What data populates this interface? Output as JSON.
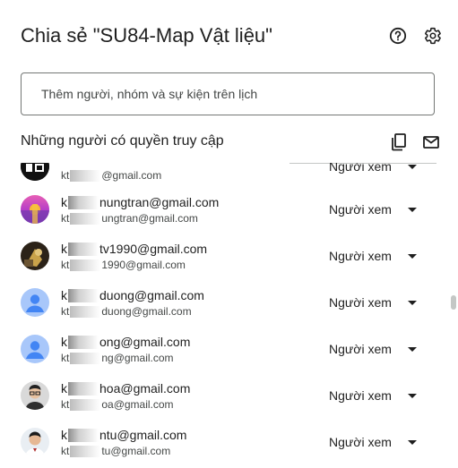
{
  "dialog": {
    "title": "Chia sẻ \"SU84-Map Vật liệu\"",
    "help_icon": "help-circle-icon",
    "settings_icon": "gear-icon"
  },
  "invite": {
    "placeholder": "Thêm người, nhóm và sự kiện trên lịch"
  },
  "access": {
    "section_title": "Những người có quyền truy cập",
    "copy_icon": "copy-icon",
    "email_icon": "mail-icon"
  },
  "people": [
    {
      "name_prefix": "",
      "name_suffix": "",
      "email_prefix": "kt",
      "email_suffix": "@gmail.com",
      "role": "Người xem",
      "avatar": "logo"
    },
    {
      "name_prefix": "k",
      "name_suffix": "nungtran@gmail.com",
      "email_prefix": "kt",
      "email_suffix": "ungtran@gmail.com",
      "role": "Người xem",
      "avatar": "pink"
    },
    {
      "name_prefix": "k",
      "name_suffix": "tv1990@gmail.com",
      "email_prefix": "kt",
      "email_suffix": "1990@gmail.com",
      "role": "Người xem",
      "avatar": "photo-dark"
    },
    {
      "name_prefix": "k",
      "name_suffix": "duong@gmail.com",
      "email_prefix": "kt",
      "email_suffix": "duong@gmail.com",
      "role": "Người xem",
      "avatar": "default"
    },
    {
      "name_prefix": "k",
      "name_suffix": "ong@gmail.com",
      "email_prefix": "kt",
      "email_suffix": "ng@gmail.com",
      "role": "Người xem",
      "avatar": "default"
    },
    {
      "name_prefix": "k",
      "name_suffix": "hoa@gmail.com",
      "email_prefix": "kt",
      "email_suffix": "oa@gmail.com",
      "role": "Người xem",
      "avatar": "person-glasses"
    },
    {
      "name_prefix": "k",
      "name_suffix": "ntu@gmail.com",
      "email_prefix": "kt",
      "email_suffix": "tu@gmail.com",
      "role": "Người xem",
      "avatar": "person"
    }
  ]
}
